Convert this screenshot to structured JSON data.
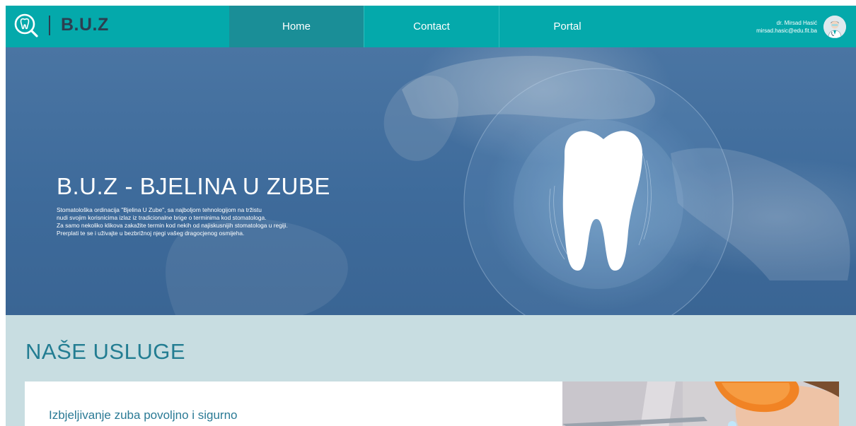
{
  "brand": {
    "name": "B.U.Z",
    "logo_icon": "tooth-magnifier-icon"
  },
  "nav": {
    "items": [
      {
        "label": "Home",
        "active": true
      },
      {
        "label": "Contact",
        "active": false
      },
      {
        "label": "Portal",
        "active": false
      }
    ]
  },
  "user": {
    "name": "dr. Mirsad Hasić",
    "email": "mirsad.hasic@edu.fit.ba",
    "avatar_icon": "doctor-avatar-icon"
  },
  "hero": {
    "title": "B.U.Z - BJELINA U ZUBE",
    "lines": [
      "Stomatološka ordinacija \"Bjelina U Zube\", sa najboljom tehnologijom na tržistu",
      "nudi svojim korisnicima izlaz iz tradicionalne brige o terminima kod stomatologa.",
      "Za samo nekoliko klikova zakažite termin kod nekih od najiskusnijih stomatologa u regiji.",
      "Prerplati te se i uživajte u bezbrižnoj njegi vašeg dragocjenog osmijeha."
    ],
    "slides": {
      "count": 3,
      "active": 1
    }
  },
  "services": {
    "title": "NAŠE USLUGE",
    "cards": [
      {
        "title": "Izbjeljivanje zuba povoljno i sigurno"
      }
    ]
  },
  "colors": {
    "navbar": "#04a9ab",
    "nav_active": "#1a8e97",
    "brand_text": "#2c3e50",
    "services_bg": "#c8dde1",
    "accent": "#237d92"
  }
}
